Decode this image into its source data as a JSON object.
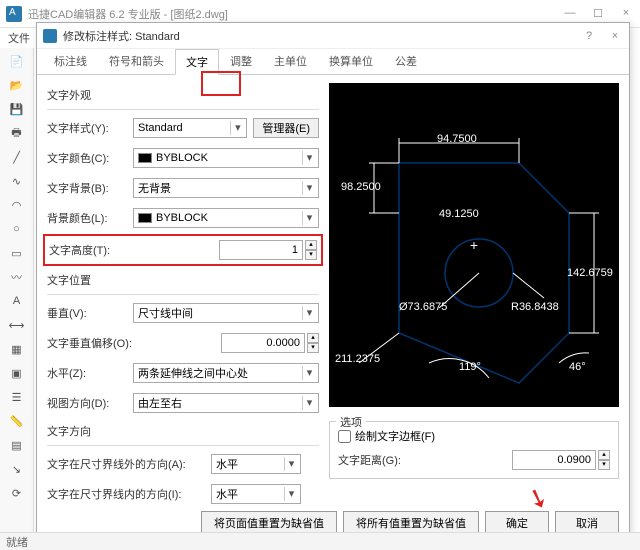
{
  "app": {
    "title": "迅捷CAD编辑器 6.2 专业版 - [图纸2.dwg]",
    "menubar_visible": "文件"
  },
  "win_btns": {
    "min": "—",
    "max": "☐",
    "close": "×"
  },
  "dialog": {
    "title": "修改标注样式: Standard",
    "tabs": [
      "标注线",
      "符号和箭头",
      "文字",
      "调整",
      "主单位",
      "换算单位",
      "公差"
    ],
    "active_tab_index": 2
  },
  "text_appearance": {
    "group": "文字外观",
    "style_label": "文字样式(Y):",
    "style_value": "Standard",
    "manager_btn": "管理器(E)",
    "color_label": "文字颜色(C):",
    "color_value": "BYBLOCK",
    "bg_label": "文字背景(B):",
    "bg_value": "无背景",
    "bgcolor_label": "背景颜色(L):",
    "bgcolor_value": "BYBLOCK",
    "height_label": "文字高度(T):",
    "height_value": "1"
  },
  "text_position": {
    "group": "文字位置",
    "vert_label": "垂直(V):",
    "vert_value": "尺寸线中间",
    "offset_label": "文字垂直偏移(O):",
    "offset_value": "0.0000",
    "horiz_label": "水平(Z):",
    "horiz_value": "两条延伸线之间中心处",
    "viewdir_label": "视图方向(D):",
    "viewdir_value": "由左至右"
  },
  "text_direction": {
    "group": "文字方向",
    "outside_label": "文字在尺寸界线外的方向(A):",
    "outside_value": "水平",
    "inside_label": "文字在尺寸界线内的方向(I):",
    "inside_value": "水平"
  },
  "options": {
    "group": "选项",
    "frame_checkbox": "绘制文字边框(F)",
    "gap_label": "文字距离(G):",
    "gap_value": "0.0900"
  },
  "buttons": {
    "reset_page": "将页面值重置为缺省值",
    "reset_all": "将所有值重置为缺省值",
    "ok": "确定",
    "cancel": "取消",
    "help_icon": "?"
  },
  "preview_dims": {
    "d1": "94.7500",
    "d2": "98.2500",
    "d3": "49.1250",
    "d4": "Ø73.6875",
    "d5": "R36.8438",
    "d6": "142.6759",
    "d7": "211.2375",
    "d8": "119°",
    "d9": "46°"
  },
  "statusbar": {
    "text": "就绪"
  },
  "toolbar_icons": [
    "file-icon",
    "open-icon",
    "save-icon",
    "print-icon",
    "line-icon",
    "polyline-icon",
    "arc-icon",
    "circle-icon",
    "rect-icon",
    "spline-icon",
    "text-icon",
    "dim-icon",
    "hatch-icon",
    "block-icon",
    "layer-icon",
    "measure-icon",
    "table-icon",
    "leader-icon",
    "sheet-icon",
    "a-icon",
    "b-icon",
    "c-icon"
  ]
}
